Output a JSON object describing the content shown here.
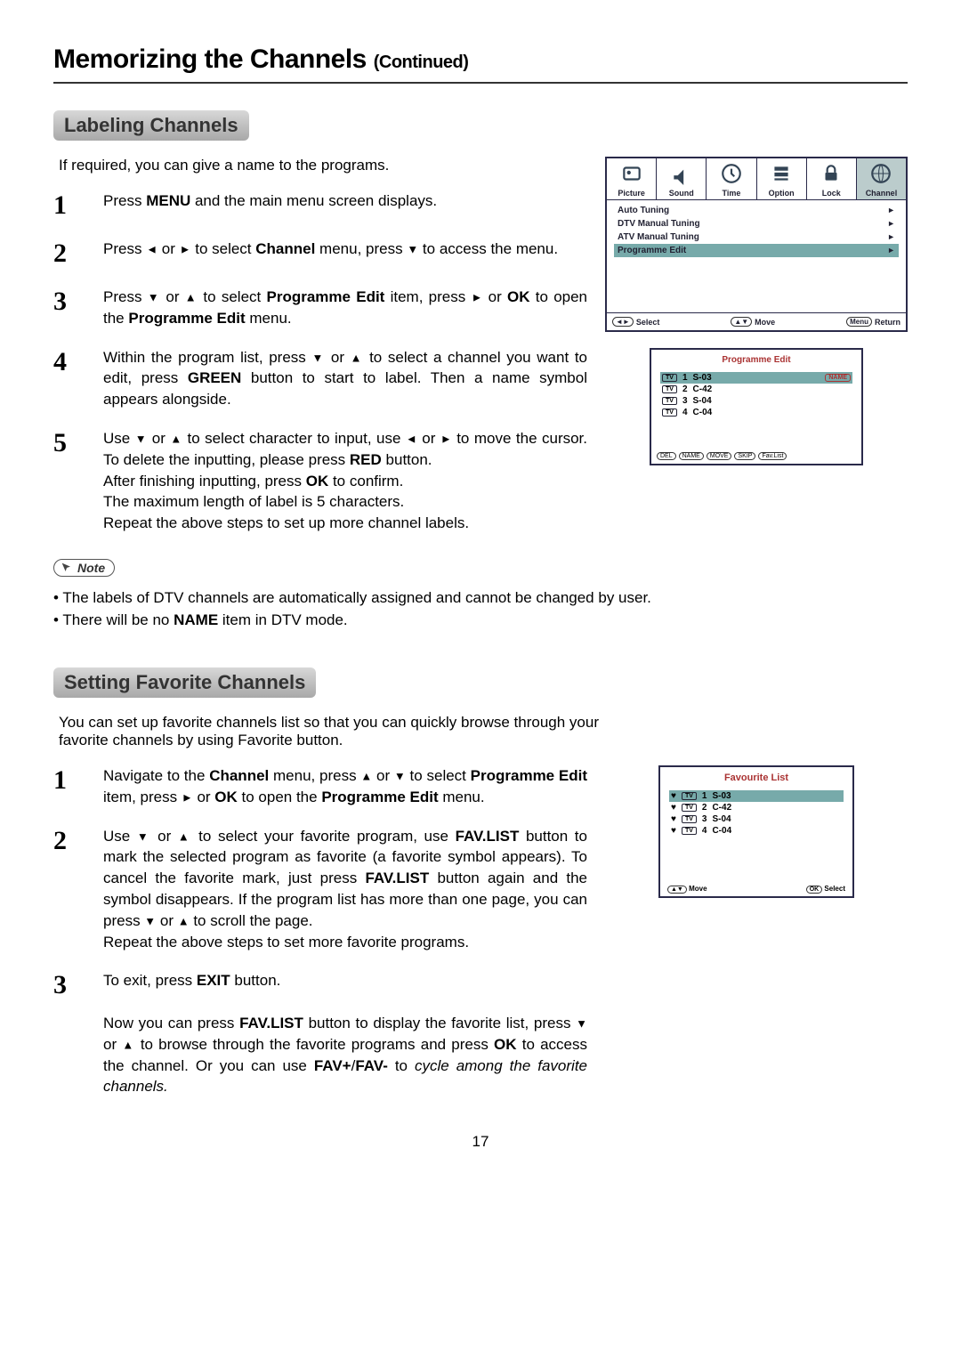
{
  "title_main": "Memorizing the Channels ",
  "title_cont": "(Continued)",
  "labeling": {
    "heading": "Labeling Channels",
    "intro": "If required, you can give a name to the programs.",
    "steps": [
      {
        "n": "1",
        "text": "Press <b>MENU</b> and the main menu screen displays."
      },
      {
        "n": "2",
        "text": "Press <span class='arrow'>◄</span> or <span class='arrow'>►</span> to select <b>Channel</b> menu, press <span class='arrow'>▼</span> to access the menu."
      },
      {
        "n": "3",
        "text": "Press <span class='arrow'>▼</span> or <span class='arrow'>▲</span> to select <b>Programme Edit</b> item, press <span class='arrow'>►</span> or <b>OK</b> to open the <b>Programme Edit</b> menu."
      },
      {
        "n": "4",
        "text": "Within the program list, press <span class='arrow'>▼</span> or <span class='arrow'>▲</span> to select a channel you want to edit, press <b>GREEN</b> button to start to label. Then a name symbol appears alongside."
      },
      {
        "n": "5",
        "text": "Use <span class='arrow'>▼</span> or <span class='arrow'>▲</span> to select character to input, use <span class='arrow'>◄</span> or <span class='arrow'>►</span> to move the cursor. To delete the inputting, please press <b>RED</b> button.<br>After finishing inputting, press <b>OK</b> to confirm.<br>The maximum length of label is 5 characters.<br>Repeat the above steps to set up more channel labels."
      }
    ]
  },
  "note": {
    "label": "Note",
    "items": [
      "The labels of DTV channels are automatically assigned and cannot be changed by user.",
      "There will be no <b>NAME</b> item in DTV mode."
    ]
  },
  "favorite": {
    "heading": "Setting Favorite Channels",
    "intro": "You can set up favorite channels list so that you can quickly browse through your favorite channels by using Favorite button.",
    "steps": [
      {
        "n": "1",
        "text": "Navigate to the <b>Channel</b> menu, press <span class='arrow'>▲</span> or <span class='arrow'>▼</span> to select <b>Programme Edit</b> item, press <span class='arrow'>►</span> or <b>OK</b> to open the <b>Programme Edit</b> menu."
      },
      {
        "n": "2",
        "text": "Use <span class='arrow'>▼</span> or <span class='arrow'>▲</span> to select your favorite program, use <b>FAV.LIST</b> button to mark the selected program as favorite (a favorite symbol appears). To cancel the favorite mark, just press <b>FAV.LIST</b> button again and the symbol disappears. If the program list has more than one page, you can press <span class='arrow'>▼</span> or <span class='arrow'>▲</span> to scroll the page.<br>Repeat the above steps to set more favorite programs."
      },
      {
        "n": "3",
        "text": "To exit, press <b>EXIT</b> button.<br><br>Now you can press <b>FAV.LIST</b> button to display the favorite list, press <span class='arrow'>▼</span> or <span class='arrow'>▲</span> to browse through the favorite programs and press <b>OK</b> to access the channel. Or you can use <b>FAV+</b>/<b>FAV-</b> to <span class='italic'>cycle among the favorite channels.</span>"
      }
    ]
  },
  "osd_channel_menu": {
    "tabs": [
      "Picture",
      "Sound",
      "Time",
      "Option",
      "Lock",
      "Channel"
    ],
    "rows": [
      "Auto Tuning",
      "DTV Manual Tuning",
      "ATV Manual Tuning",
      "Programme Edit"
    ],
    "footer": {
      "select": "Select",
      "move": "Move",
      "menu": "Menu",
      "return": "Return"
    }
  },
  "osd_programme_edit": {
    "title": "Programme Edit",
    "channels": [
      {
        "n": "1",
        "name": "S-03",
        "hl": true,
        "badge": "NAME"
      },
      {
        "n": "2",
        "name": "C-42"
      },
      {
        "n": "3",
        "name": "S-04"
      },
      {
        "n": "4",
        "name": "C-04"
      }
    ],
    "buttons": [
      "DEL",
      "NAME",
      "MOVE",
      "SKIP",
      "Fav.List"
    ]
  },
  "osd_fav_list": {
    "title": "Favourite List",
    "channels": [
      {
        "n": "1",
        "name": "S-03",
        "hl": true
      },
      {
        "n": "2",
        "name": "C-42"
      },
      {
        "n": "3",
        "name": "S-04"
      },
      {
        "n": "4",
        "name": "C-04"
      }
    ],
    "footer": {
      "move": "Move",
      "ok": "OK",
      "select": "Select"
    }
  },
  "page_number": "17"
}
